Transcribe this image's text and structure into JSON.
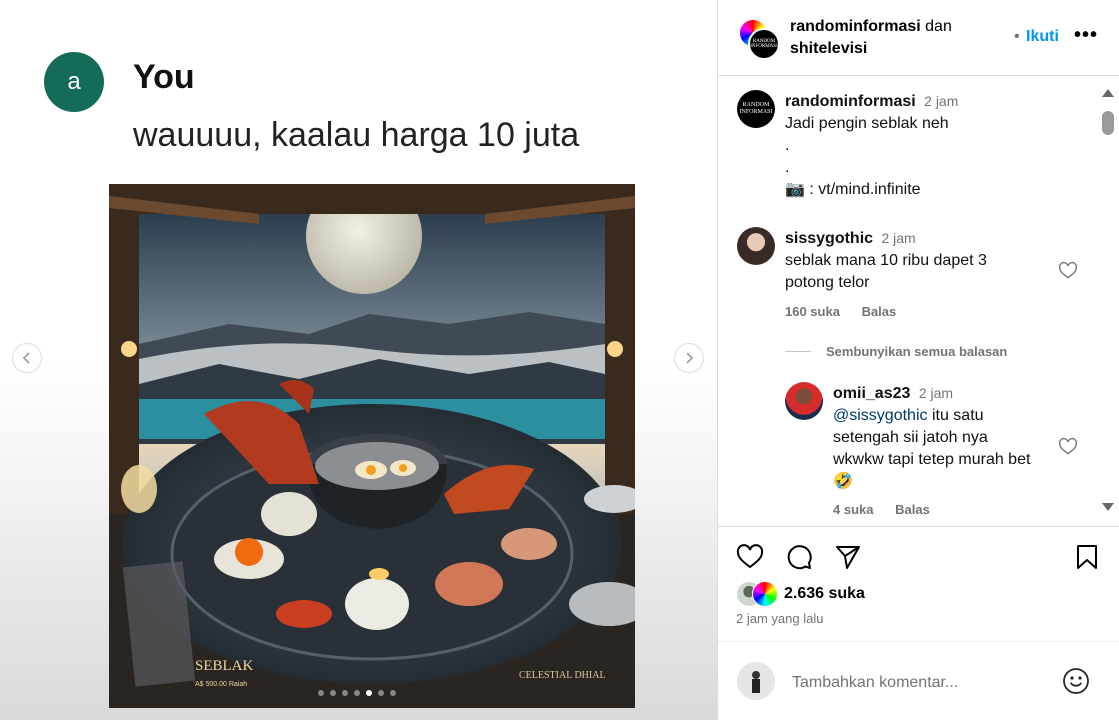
{
  "media": {
    "avatar_letter": "a",
    "author": "You",
    "message": "wauuuu, kaalau harga 10 juta",
    "image_title": "SEBLAK",
    "image_price": "A$ 500.00 Raiah",
    "image_brand": "CELESTIAL DHIAL",
    "prev_icon": "chevron-left-icon",
    "next_icon": "chevron-right-icon",
    "carousel_total": 7,
    "carousel_active": 5
  },
  "header": {
    "account1": "randominformasi",
    "conj": "dan",
    "account2": "shitelevisi",
    "follow_label": "Ikuti",
    "more_label": "•••"
  },
  "caption": {
    "username": "randominformasi",
    "time": "2 jam",
    "line1": "Jadi pengin seblak neh",
    "dot1": ".",
    "dot2": ".",
    "credit_emoji": "📷",
    "credit": ": vt/mind.infinite"
  },
  "comments": [
    {
      "username": "sissygothic",
      "time": "2 jam",
      "text1": "seblak mana 10 ribu dapet 3",
      "text2": "potong telor",
      "likes": "160 suka",
      "reply_label": "Balas"
    }
  ],
  "hide_replies_label": "Sembunyikan semua balasan",
  "reply": {
    "username": "omii_as23",
    "time": "2 jam",
    "mention": "@sissygothic",
    "text1": "itu satu",
    "text2": "setengah sii jatoh nya",
    "text3": "wkwkw tapi tetep murah bet",
    "emoji": "🤣",
    "likes": "4 suka",
    "reply_label": "Balas"
  },
  "actions": {
    "like_icon": "heart-icon",
    "comment_icon": "comment-icon",
    "share_icon": "send-icon",
    "save_icon": "bookmark-icon"
  },
  "likes_count": "2.636 suka",
  "posted_ago": "2 jam yang lalu",
  "comment_input": {
    "placeholder": "Tambahkan komentar..."
  },
  "colors": {
    "accent": "#0095f6",
    "avatar_green": "#136b58",
    "muted": "#737373"
  }
}
